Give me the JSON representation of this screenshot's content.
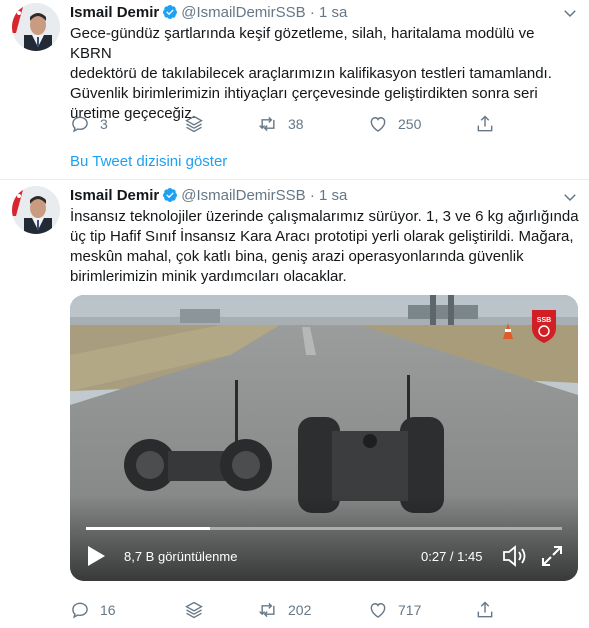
{
  "tweet1": {
    "name": "Ismail Demir",
    "handle": "@IsmailDemirSSB",
    "separator": "·",
    "time": "1 sa",
    "text_lines": [
      "Gece-gündüz şartlarında keşif gözetleme, silah, haritalama modülü ve KBRN",
      "dedektörü de takılabilecek araçlarımızın kalifikasyon testleri tamamlandı.",
      "Güvenlik birimlerimizin ihtiyaçları çerçevesinde geliştirdikten sonra seri",
      "üretime geçeceğiz."
    ],
    "replies": "3",
    "retweets": "38",
    "likes": "250"
  },
  "thread_link": "Bu Tweet dizisini göster",
  "tweet2": {
    "name": "Ismail Demir",
    "handle": "@IsmailDemirSSB",
    "separator": "·",
    "time": "1 sa",
    "text_lines": [
      "İnsansız teknolojiler üzerinde çalışmalarımız sürüyor. 1, 3 ve 6 kg ağırlığında",
      "üç tip Hafif Sınıf İnsansız Kara Aracı prototipi yerli olarak geliştirildi. Mağara,",
      "meskûn mahal, çok katlı bina, geniş arazi operasyonlarında güvenlik",
      "birimlerimizin minik yardımcıları olacaklar."
    ],
    "video": {
      "views": "8,7 B görüntülenme",
      "duration": "0:27 / 1:45",
      "progress": 0.26,
      "badge_text": "SSB"
    },
    "replies": "16",
    "retweets": "202",
    "likes": "717"
  },
  "colors": {
    "text": "#14171a",
    "secondary": "#657786",
    "link": "#1da1f2",
    "verified": "#1da1f2",
    "divider": "#e6ecf0"
  },
  "icons": [
    "verified-badge-icon",
    "chevron-down-icon",
    "reply-icon",
    "layers-icon",
    "retweet-icon",
    "heart-icon",
    "share-icon",
    "play-icon",
    "volume-icon",
    "fullscreen-icon"
  ]
}
